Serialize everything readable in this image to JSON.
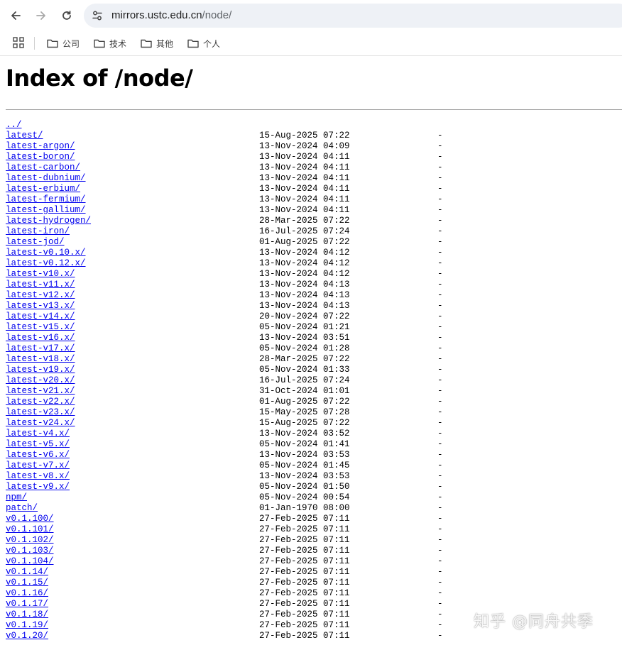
{
  "browser": {
    "url_host": "mirrors.ustc.edu.cn",
    "url_path": "/node/",
    "bookmarks": [
      {
        "label": "公司"
      },
      {
        "label": "技术"
      },
      {
        "label": "其他"
      },
      {
        "label": "个人"
      }
    ]
  },
  "page": {
    "title": "Index of /node/",
    "parent_link": "../",
    "entries": [
      {
        "name": "latest/",
        "date": "15-Aug-2025 07:22",
        "size": "-"
      },
      {
        "name": "latest-argon/",
        "date": "13-Nov-2024 04:09",
        "size": "-"
      },
      {
        "name": "latest-boron/",
        "date": "13-Nov-2024 04:11",
        "size": "-"
      },
      {
        "name": "latest-carbon/",
        "date": "13-Nov-2024 04:11",
        "size": "-"
      },
      {
        "name": "latest-dubnium/",
        "date": "13-Nov-2024 04:11",
        "size": "-"
      },
      {
        "name": "latest-erbium/",
        "date": "13-Nov-2024 04:11",
        "size": "-"
      },
      {
        "name": "latest-fermium/",
        "date": "13-Nov-2024 04:11",
        "size": "-"
      },
      {
        "name": "latest-gallium/",
        "date": "13-Nov-2024 04:11",
        "size": "-"
      },
      {
        "name": "latest-hydrogen/",
        "date": "28-Mar-2025 07:22",
        "size": "-"
      },
      {
        "name": "latest-iron/",
        "date": "16-Jul-2025 07:24",
        "size": "-"
      },
      {
        "name": "latest-jod/",
        "date": "01-Aug-2025 07:22",
        "size": "-"
      },
      {
        "name": "latest-v0.10.x/",
        "date": "13-Nov-2024 04:12",
        "size": "-"
      },
      {
        "name": "latest-v0.12.x/",
        "date": "13-Nov-2024 04:12",
        "size": "-"
      },
      {
        "name": "latest-v10.x/",
        "date": "13-Nov-2024 04:12",
        "size": "-"
      },
      {
        "name": "latest-v11.x/",
        "date": "13-Nov-2024 04:13",
        "size": "-"
      },
      {
        "name": "latest-v12.x/",
        "date": "13-Nov-2024 04:13",
        "size": "-"
      },
      {
        "name": "latest-v13.x/",
        "date": "13-Nov-2024 04:13",
        "size": "-"
      },
      {
        "name": "latest-v14.x/",
        "date": "20-Nov-2024 07:22",
        "size": "-"
      },
      {
        "name": "latest-v15.x/",
        "date": "05-Nov-2024 01:21",
        "size": "-"
      },
      {
        "name": "latest-v16.x/",
        "date": "13-Nov-2024 03:51",
        "size": "-"
      },
      {
        "name": "latest-v17.x/",
        "date": "05-Nov-2024 01:28",
        "size": "-"
      },
      {
        "name": "latest-v18.x/",
        "date": "28-Mar-2025 07:22",
        "size": "-"
      },
      {
        "name": "latest-v19.x/",
        "date": "05-Nov-2024 01:33",
        "size": "-"
      },
      {
        "name": "latest-v20.x/",
        "date": "16-Jul-2025 07:24",
        "size": "-"
      },
      {
        "name": "latest-v21.x/",
        "date": "31-Oct-2024 01:01",
        "size": "-"
      },
      {
        "name": "latest-v22.x/",
        "date": "01-Aug-2025 07:22",
        "size": "-"
      },
      {
        "name": "latest-v23.x/",
        "date": "15-May-2025 07:28",
        "size": "-"
      },
      {
        "name": "latest-v24.x/",
        "date": "15-Aug-2025 07:22",
        "size": "-"
      },
      {
        "name": "latest-v4.x/",
        "date": "13-Nov-2024 03:52",
        "size": "-"
      },
      {
        "name": "latest-v5.x/",
        "date": "05-Nov-2024 01:41",
        "size": "-"
      },
      {
        "name": "latest-v6.x/",
        "date": "13-Nov-2024 03:53",
        "size": "-"
      },
      {
        "name": "latest-v7.x/",
        "date": "05-Nov-2024 01:45",
        "size": "-"
      },
      {
        "name": "latest-v8.x/",
        "date": "13-Nov-2024 03:53",
        "size": "-"
      },
      {
        "name": "latest-v9.x/",
        "date": "05-Nov-2024 01:50",
        "size": "-"
      },
      {
        "name": "npm/",
        "date": "05-Nov-2024 00:54",
        "size": "-"
      },
      {
        "name": "patch/",
        "date": "01-Jan-1970 08:00",
        "size": "-"
      },
      {
        "name": "v0.1.100/",
        "date": "27-Feb-2025 07:11",
        "size": "-"
      },
      {
        "name": "v0.1.101/",
        "date": "27-Feb-2025 07:11",
        "size": "-"
      },
      {
        "name": "v0.1.102/",
        "date": "27-Feb-2025 07:11",
        "size": "-"
      },
      {
        "name": "v0.1.103/",
        "date": "27-Feb-2025 07:11",
        "size": "-"
      },
      {
        "name": "v0.1.104/",
        "date": "27-Feb-2025 07:11",
        "size": "-"
      },
      {
        "name": "v0.1.14/",
        "date": "27-Feb-2025 07:11",
        "size": "-"
      },
      {
        "name": "v0.1.15/",
        "date": "27-Feb-2025 07:11",
        "size": "-"
      },
      {
        "name": "v0.1.16/",
        "date": "27-Feb-2025 07:11",
        "size": "-"
      },
      {
        "name": "v0.1.17/",
        "date": "27-Feb-2025 07:11",
        "size": "-"
      },
      {
        "name": "v0.1.18/",
        "date": "27-Feb-2025 07:11",
        "size": "-"
      },
      {
        "name": "v0.1.19/",
        "date": "27-Feb-2025 07:11",
        "size": "-"
      },
      {
        "name": "v0.1.20/",
        "date": "27-Feb-2025 07:11",
        "size": "-"
      }
    ]
  },
  "watermark": "知乎 @同舟共季"
}
